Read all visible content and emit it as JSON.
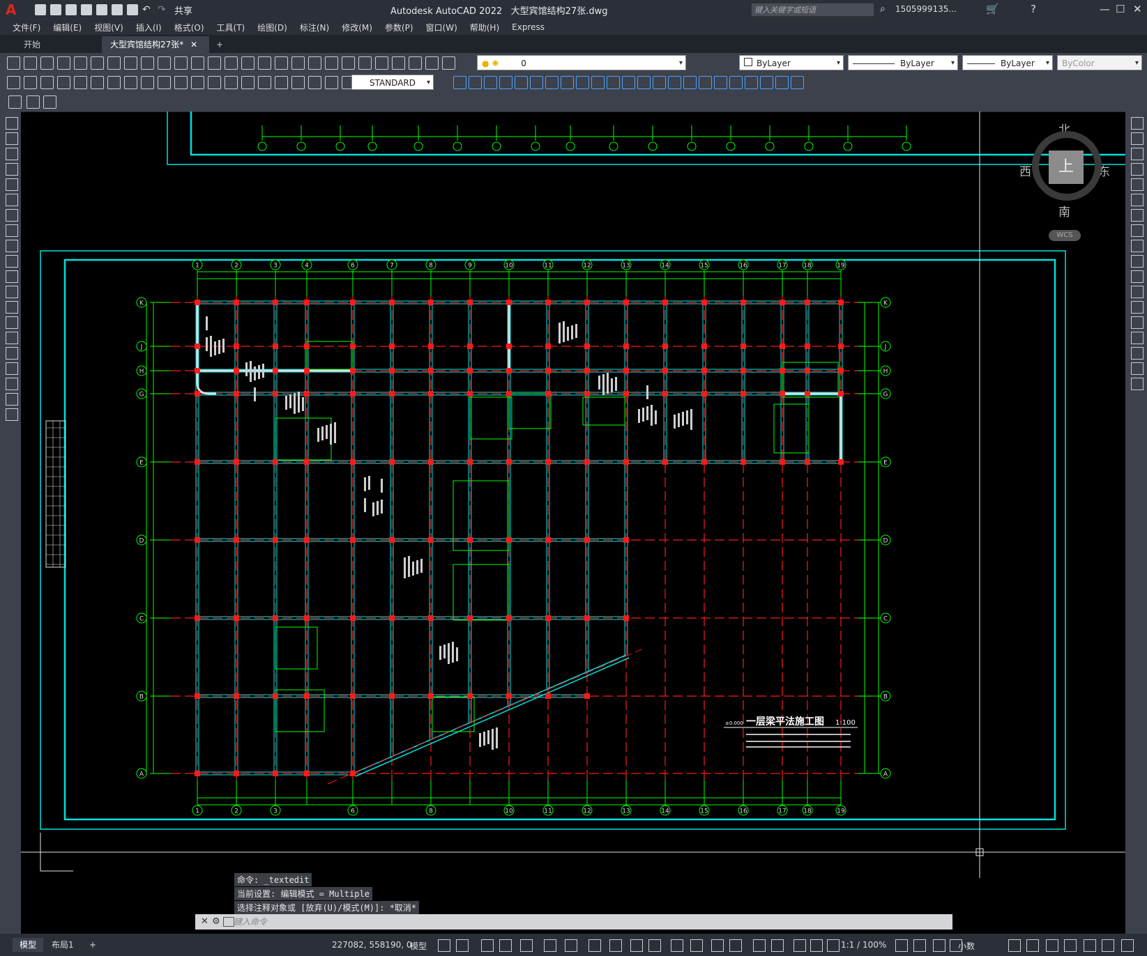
{
  "app": {
    "title": "Autodesk AutoCAD 2022",
    "file": "大型宾馆结构27张.dwg",
    "share": "共享",
    "search_placeholder": "键入关键字或短语",
    "user": "1505999135...",
    "logo": "A"
  },
  "menu": [
    "文件(F)",
    "编辑(E)",
    "视图(V)",
    "插入(I)",
    "格式(O)",
    "工具(T)",
    "绘图(D)",
    "标注(N)",
    "修改(M)",
    "参数(P)",
    "窗口(W)",
    "帮助(H)",
    "Express"
  ],
  "tabs": {
    "start": "开始",
    "active": "大型宾馆结构27张*",
    "add": "+"
  },
  "layer_toolbar": {
    "layer": "0",
    "color": "ByLayer",
    "linetype": "ByLayer",
    "lineweight": "ByLayer",
    "plotstyle": "ByColor"
  },
  "dim_toolbar": {
    "style": "STANDARD"
  },
  "viewcube": {
    "north": "北",
    "south": "南",
    "east": "东",
    "west": "西",
    "face": "上",
    "wcs": "WCS"
  },
  "drawing": {
    "grid_top": [
      "1",
      "2",
      "3",
      "4",
      "6",
      "7",
      "8",
      "9",
      "10",
      "11",
      "12",
      "13",
      "14",
      "15",
      "16",
      "17",
      "18",
      "19"
    ],
    "grid_bottom": [
      "1",
      "2",
      "3",
      "6",
      "8",
      "10",
      "11",
      "12",
      "13",
      "14",
      "15",
      "16",
      "17",
      "18",
      "19"
    ],
    "grid_rows": [
      "K",
      "J",
      "H",
      "G",
      "E",
      "D",
      "C",
      "B",
      "A"
    ],
    "plan_title": "一层梁平法施工图",
    "plan_scale": "1:100",
    "elevation_tag": "±0.000"
  },
  "command": {
    "history": [
      "命令: _textedit",
      "当前设置: 编辑模式 = Multiple",
      "选择注释对象或 [放弃(U)/模式(M)]: *取消*"
    ],
    "prompt": "键入命令"
  },
  "status": {
    "model_tab": "模型",
    "layout_tab": "布局1",
    "add": "+",
    "coords": "227082, 558190, 0",
    "space": "模型",
    "scale": "1:1 / 100%",
    "units": "小数"
  },
  "colors": {
    "cyan": "#00e0e0",
    "green": "#00ff00",
    "red": "#ff1a1a",
    "white": "#ffffff",
    "ui_dark": "#2b2f38",
    "ui_mid": "#3c414b"
  }
}
